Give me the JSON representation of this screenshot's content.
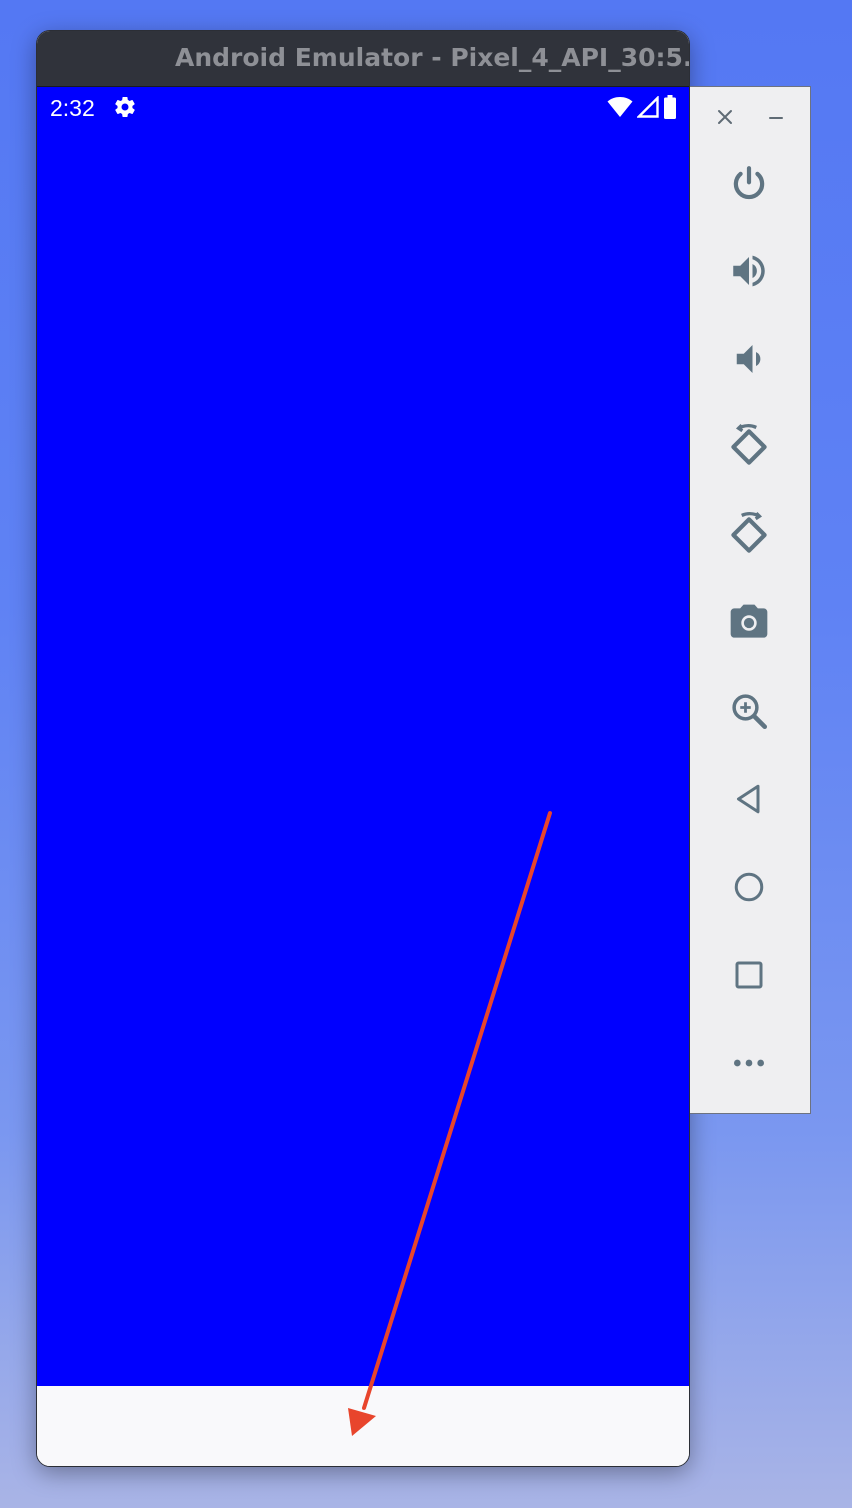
{
  "window": {
    "title": "Android Emulator - Pixel_4_API_30:5..."
  },
  "status_bar": {
    "time": "2:32",
    "icons": [
      "settings-gear-icon",
      "wifi-icon",
      "signal-icon",
      "battery-icon"
    ]
  },
  "app": {
    "background_color": "#0000ff",
    "nav_area_color": "#f9f9fb"
  },
  "annotation": {
    "arrow_color": "#e8452c"
  },
  "toolbar": {
    "window_controls": [
      "close-icon",
      "minimize-icon"
    ],
    "buttons": [
      "power-icon",
      "volume-up-icon",
      "volume-down-icon",
      "rotate-left-icon",
      "rotate-right-icon",
      "camera-icon",
      "zoom-icon",
      "back-icon",
      "home-icon",
      "overview-icon",
      "more-icon"
    ],
    "icon_color": "#5f7482"
  }
}
